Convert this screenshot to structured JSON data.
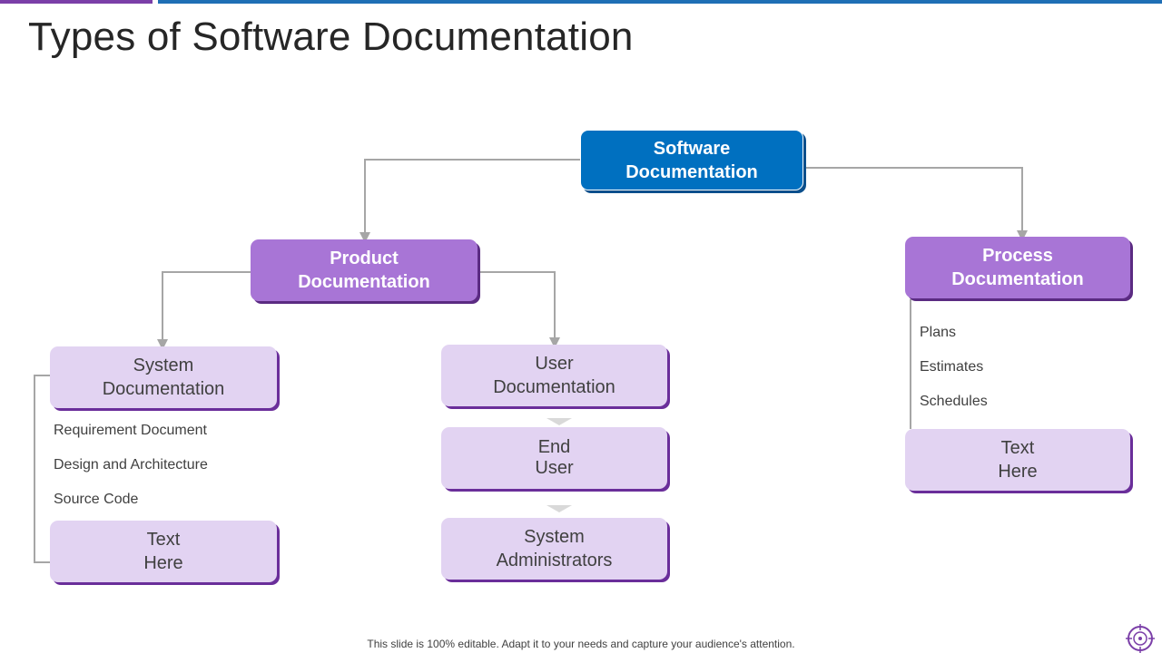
{
  "title": "Types of Software Documentation",
  "nodes": {
    "root": "Software\nDocumentation",
    "product": "Product\nDocumentation",
    "process": "Process\nDocumentation",
    "system": "System\nDocumentation",
    "user": "User\nDocumentation",
    "end_user": "End\nUser",
    "sys_admins": "System\nAdministrators",
    "text_here_left": "Text\nHere",
    "text_here_right": "Text\nHere"
  },
  "system_items": [
    "Requirement  Document",
    "Design and Architecture",
    "Source Code"
  ],
  "process_items": [
    "Plans",
    "Estimates",
    "Schedules"
  ],
  "footer": "This slide is 100% editable. Adapt it to your needs and capture your audience's attention.",
  "colors": {
    "root_fill": "#0070c0",
    "level1_fill": "#a875d6",
    "level2_fill": "#e2d3f2",
    "shadow_purple": "#6a2e9a",
    "connector": "#a6a6a6"
  },
  "icons": {
    "logo": "target-crosshair-icon"
  }
}
